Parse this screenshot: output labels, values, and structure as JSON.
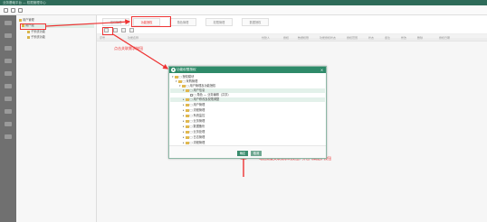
{
  "window": {
    "title": "业务基础平台 — 权限管理中心"
  },
  "tree": {
    "items": [
      {
        "label": "用户管理"
      },
      {
        "label": "用户组"
      },
      {
        "label": "子系统功能"
      },
      {
        "label": "子系统功能"
      }
    ]
  },
  "tabs": [
    {
      "label": "组织管理"
    },
    {
      "label": "功能授权"
    },
    {
      "label": "角色管理"
    },
    {
      "label": "权限管理"
    },
    {
      "label": "数据授权"
    }
  ],
  "table": {
    "columns": [
      "序号",
      "功能名称",
      "创建人",
      "授权",
      "数据权限",
      "功能授权状态",
      "授权范围",
      "状态",
      "备注",
      "修改",
      "删除",
      "授权日期"
    ]
  },
  "annotations": {
    "step1": "点击关联需求按钮",
    "step2": "勾选需要关联需求的按钮，并击【确定】按钮"
  },
  "dialog": {
    "title": "功能权限授权",
    "close_glyph": "×",
    "nodes": [
      {
        "label": "□ 授权模块"
      },
      {
        "label": "□ 采购管理"
      },
      {
        "label": "□ 用户管理及功能授权"
      },
      {
        "label": "□ 用户信息"
      },
      {
        "label": "□ 角色 — 业务编辑（共享）"
      },
      {
        "label": "□ 用户修改及权限调整"
      },
      {
        "label": "□ 用户管理"
      },
      {
        "label": "□ 流程管理"
      },
      {
        "label": "□ 系统监控"
      },
      {
        "label": "□ 业务管理"
      },
      {
        "label": "□ 数据备份"
      },
      {
        "label": "□ 业务处理"
      },
      {
        "label": "□ 日志管理"
      },
      {
        "label": "□ 流程管理"
      },
      {
        "label": "□ 用户授权"
      }
    ],
    "ok_label": "确定",
    "cancel_label": "取消"
  }
}
